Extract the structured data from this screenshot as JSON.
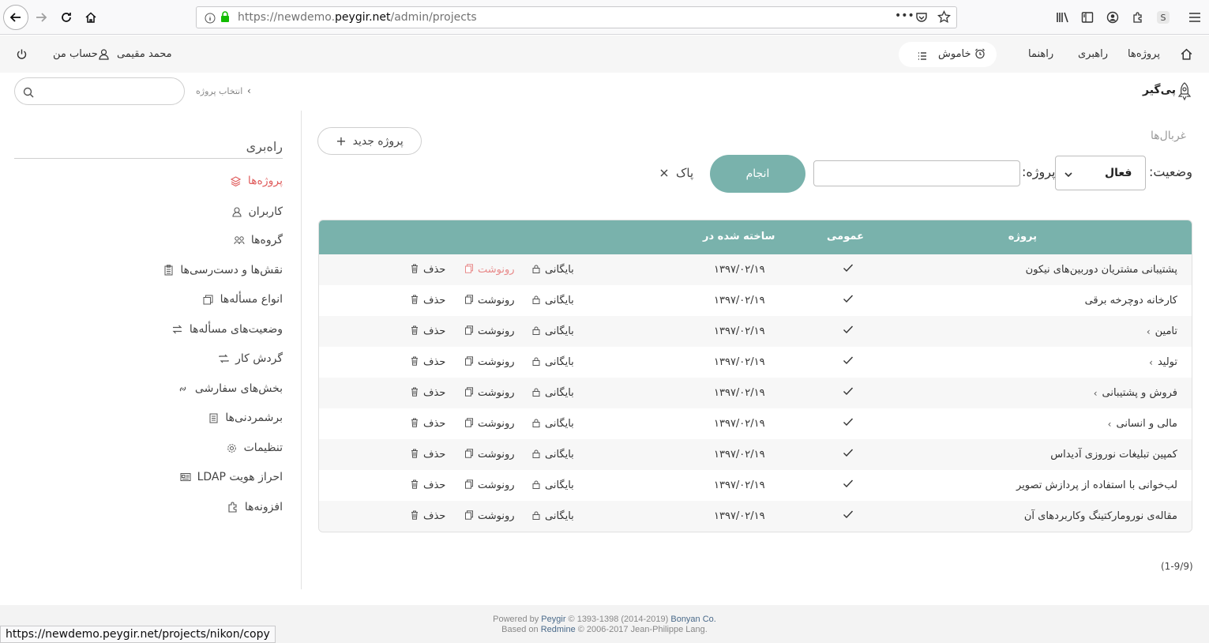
{
  "browser": {
    "url_prefix": "https://newdemo.",
    "url_host": "peygir.net",
    "url_path": "/admin/projects",
    "status_url": "https://newdemo.peygir.net/projects/nikon/copy"
  },
  "topbar": {
    "home": "",
    "projects": "پروژه‌ها",
    "admin": "راهبری",
    "help": "راهنما",
    "silent": "خاموش",
    "user_name": "محمد مقیمی",
    "my_account": "حساب من"
  },
  "subbar": {
    "brand": "پی‌گیر",
    "select_project": "انتخاب پروژه",
    "search_placeholder": ""
  },
  "sidebar": {
    "title": "راه‌بری",
    "items": [
      {
        "label": "پروژه‌ها",
        "icon": "layers-icon"
      },
      {
        "label": "کاربران",
        "icon": "user-icon"
      },
      {
        "label": "گروه‌ها",
        "icon": "group-icon"
      },
      {
        "label": "نقش‌ها و دست‌رسی‌ها",
        "icon": "clipboard-icon"
      },
      {
        "label": "انواع مسأله‌ها",
        "icon": "copy-icon"
      },
      {
        "label": "وضعیت‌های مسأله‌ها",
        "icon": "swap-icon"
      },
      {
        "label": "گردش کار",
        "icon": "workflow-icon"
      },
      {
        "label": "بخش‌های سفارشی",
        "icon": "link-icon"
      },
      {
        "label": "برشمردنی‌ها",
        "icon": "list-icon"
      },
      {
        "label": "تنظیمات",
        "icon": "gear-icon"
      },
      {
        "label": "احراز هویت LDAP",
        "icon": "id-card-icon"
      },
      {
        "label": "افزونه‌ها",
        "icon": "puzzle-icon"
      }
    ]
  },
  "filters": {
    "title": "غربال‌ها",
    "new_project": "پروژه جدید",
    "status_label": "وضعیت:",
    "status_value": "فعال",
    "project_label": "پروژه:",
    "project_value": "",
    "apply": "انجام",
    "clear": "پاک"
  },
  "table": {
    "headers": {
      "project": "پروژه",
      "public": "عمومی",
      "created": "ساخته شده در"
    },
    "actions": {
      "archive": "بایگانی",
      "copy": "رونوشت",
      "delete": "حذف"
    },
    "rows": [
      {
        "name": "پشتیبانی مشتریان دوربین‌های نیکون",
        "child": false,
        "public": true,
        "created": "۱۳۹۷/۰۲/۱۹"
      },
      {
        "name": "کارخانه دوچرخه برقی",
        "child": false,
        "public": true,
        "created": "۱۳۹۷/۰۲/۱۹"
      },
      {
        "name": "تامین",
        "child": true,
        "public": true,
        "created": "۱۳۹۷/۰۲/۱۹"
      },
      {
        "name": "تولید",
        "child": true,
        "public": true,
        "created": "۱۳۹۷/۰۲/۱۹"
      },
      {
        "name": "فروش و پشتیبانی",
        "child": true,
        "public": true,
        "created": "۱۳۹۷/۰۲/۱۹"
      },
      {
        "name": "مالی و انسانی",
        "child": true,
        "public": true,
        "created": "۱۳۹۷/۰۲/۱۹"
      },
      {
        "name": "کمپین تبلیغات نوروزی آدیداس",
        "child": false,
        "public": true,
        "created": "۱۳۹۷/۰۲/۱۹"
      },
      {
        "name": "لب‌خوانی با استفاده از پردازش تصویر",
        "child": false,
        "public": true,
        "created": "۱۳۹۷/۰۲/۱۹"
      },
      {
        "name": "مقاله‌ی نورومارکتینگ وکاربردهای آن",
        "child": false,
        "public": true,
        "created": "۱۳۹۷/۰۲/۱۹"
      }
    ]
  },
  "pagination": "(1-9/9)",
  "footer": {
    "line1_pre": "Powered by ",
    "line1_brand": "Peygir",
    "line1_mid": " © 1393-1398 (2014-2019) ",
    "line1_co": "Bonyan Co.",
    "line2_pre": "Based on ",
    "line2_brand": "Redmine",
    "line2_post": " © 2006-2017 Jean-Philippe Lang."
  },
  "colors": {
    "accent": "#79b2ac",
    "active": "#e05e5e"
  }
}
